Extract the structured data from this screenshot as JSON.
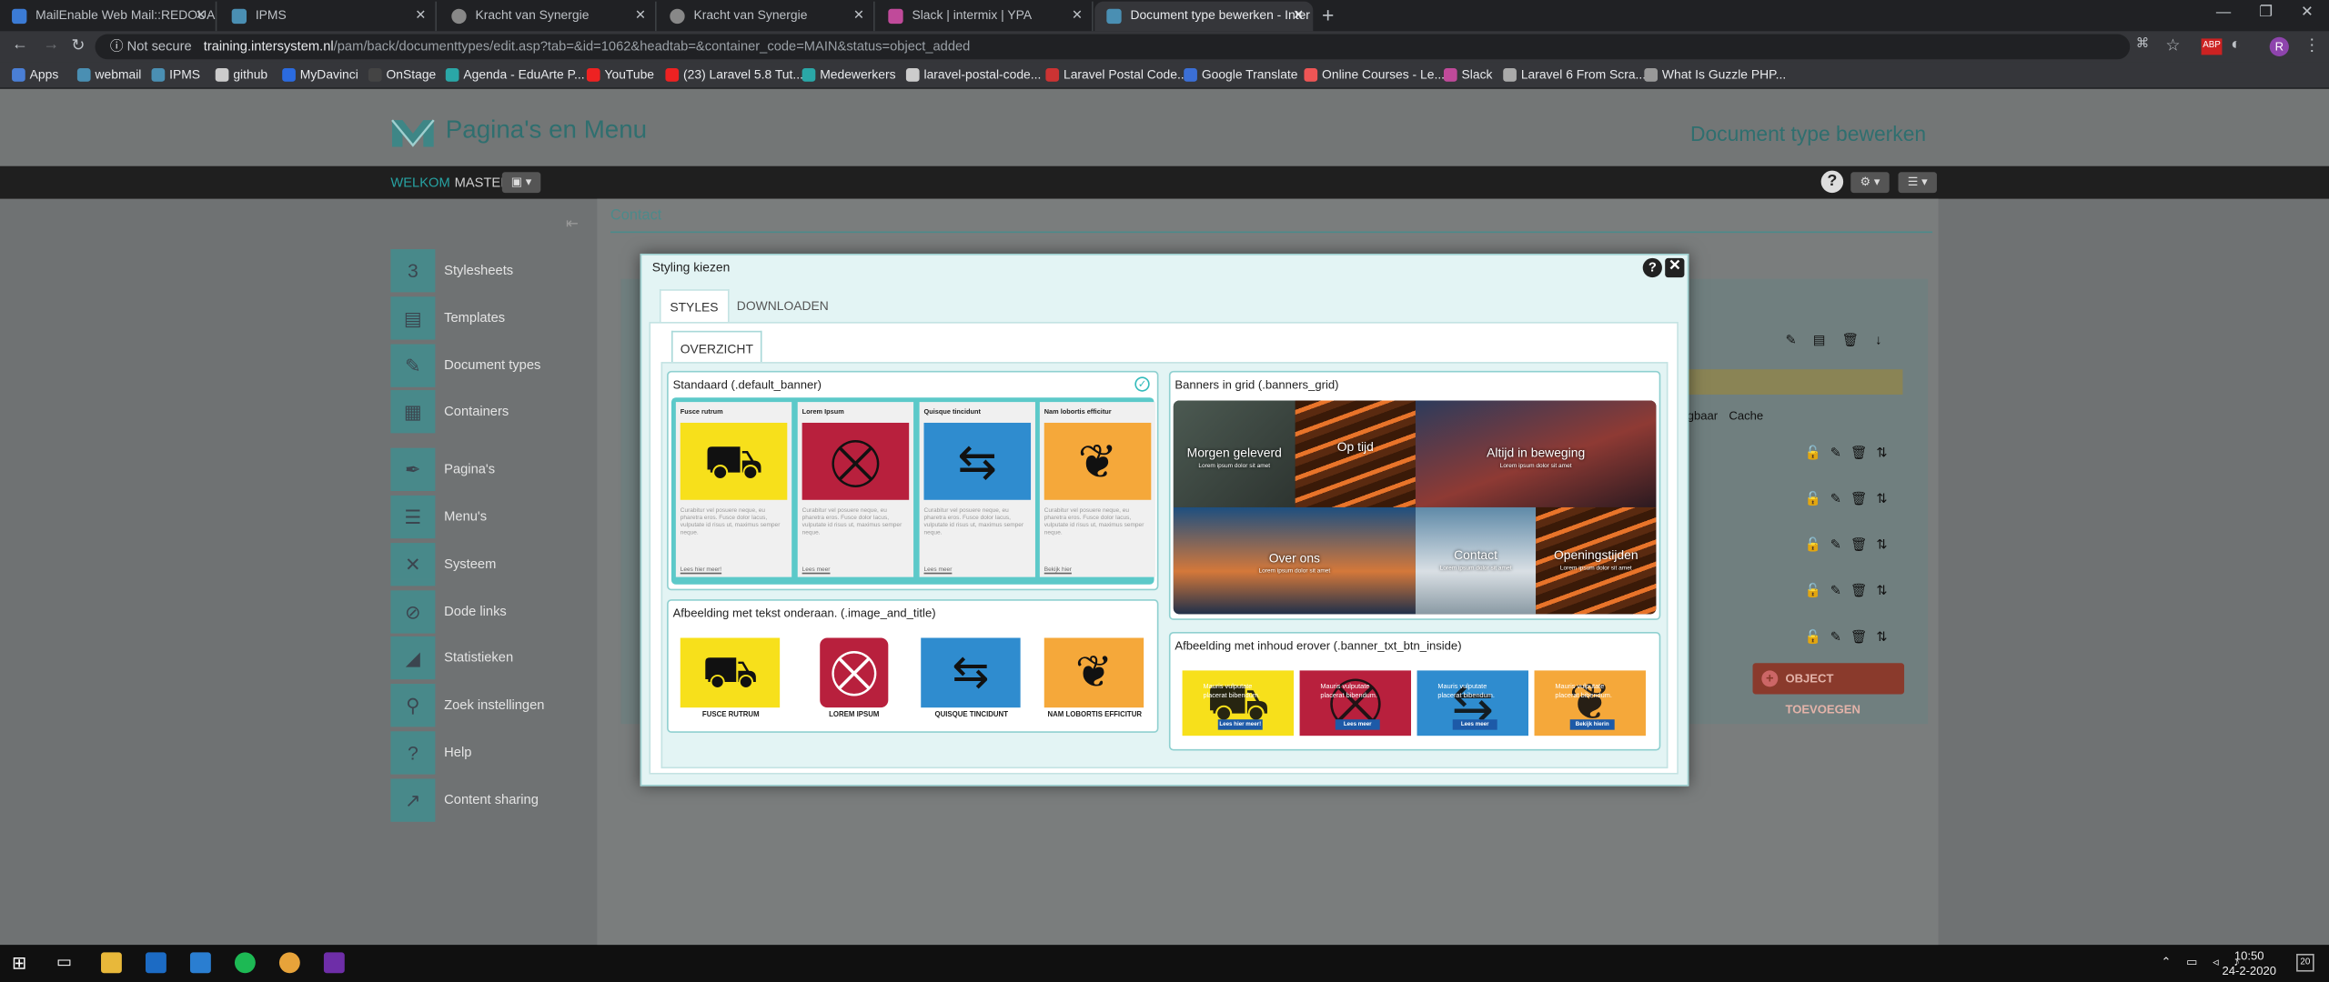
{
  "browser": {
    "tabs": [
      {
        "label": "MailEnable Web Mail::REDOUAN",
        "active": false
      },
      {
        "label": "IPMS",
        "active": false
      },
      {
        "label": "Kracht van Synergie",
        "active": false
      },
      {
        "label": "Kracht van Synergie",
        "active": false
      },
      {
        "label": "Slack | intermix | YPA",
        "active": false
      },
      {
        "label": "Document type bewerken - Inter",
        "active": true
      }
    ],
    "not_secure": "Not secure",
    "url_host": "training.intersystem.nl",
    "url_rest": "/pam/back/documenttypes/edit.asp?tab=&id=1062&headtab=&container_code=MAIN&status=object_added",
    "bookmarks": [
      "Apps",
      "webmail",
      "IPMS",
      "github",
      "MyDavinci",
      "OnStage",
      "Agenda - EduArte P...",
      "YouTube",
      "(23) Laravel 5.8 Tut...",
      "Medewerkers",
      "laravel-postal-code...",
      "Laravel Postal Code...",
      "Google Translate",
      "Online Courses - Le...",
      "Slack",
      "Laravel 6 From Scra...",
      "What Is Guzzle PHP..."
    ]
  },
  "app": {
    "title": "Pagina's en Menu",
    "subtitle": "Document type bewerken",
    "welkom": "WELKOM",
    "user": "MASTER",
    "sidebar": [
      "Stylesheets",
      "Templates",
      "Document types",
      "Containers",
      "Pagina's",
      "Menu's",
      "Systeem",
      "Dode links",
      "Statistieken",
      "Zoek instellingen",
      "Help",
      "Content sharing"
    ],
    "contact": "Contact",
    "object_button": "OBJECT TOEVOEGEN",
    "col_zichtbaar": "gbaar",
    "col_cache": "Cache"
  },
  "modal": {
    "title": "Styling kiezen",
    "tabs": [
      "STYLES",
      "DOWNLOADEN"
    ],
    "subtab": "OVERZICHT",
    "cards": {
      "default_banner": {
        "title": "Standaard (.default_banner)",
        "items": [
          {
            "heading": "Fusce rutrum",
            "link": "Lees hier meer!",
            "color": "#f7e01b"
          },
          {
            "heading": "Lorem Ipsum",
            "link": "Lees meer",
            "color": "#b8203d"
          },
          {
            "heading": "Quisque tincidunt",
            "link": "Lees meer",
            "color": "#2f8ccf"
          },
          {
            "heading": "Nam lobortis efficitur",
            "link": "Bekijk hier",
            "color": "#f5a83a"
          }
        ],
        "body": "Curabitur vel posuere neque, eu pharetra eros. Fusce dolor lacus, vulputate id risus ut, maximus semper neque."
      },
      "banners_grid": {
        "title": "Banners in grid (.banners_grid)",
        "cells": [
          "Morgen geleverd",
          "Op tijd",
          "Altijd in beweging",
          "Over ons",
          "Contact",
          "Openingstijden"
        ],
        "cell_sub": "Lorem ipsum dolor sit amet"
      },
      "image_and_title": {
        "title": "Afbeelding met tekst onderaan. (.image_and_title)",
        "captions": [
          "FUSCE RUTRUM",
          "LOREM IPSUM",
          "QUISQUE TINCIDUNT",
          "NAM LOBORTIS EFFICITUR"
        ]
      },
      "banner_txt_btn_inside": {
        "title": "Afbeelding met inhoud erover (.banner_txt_btn_inside)",
        "texts": [
          "Mauris vulputate placerat bibendum.",
          "Mauris vulputate placerat bibendum.",
          "Mauris vulputate placerat bibendum.",
          "Mauris vulputate placerat bibendum."
        ],
        "buttons": [
          "Lees hier meer!",
          "Lees meer",
          "Lees meer",
          "Bekijk hierin"
        ]
      }
    }
  },
  "taskbar": {
    "time": "10:50",
    "date": "24-2-2020"
  },
  "colors": {
    "accent": "#2a9d9d",
    "yellow": "#f7e01b",
    "red": "#b8203d",
    "blue": "#2f8ccf",
    "orange": "#f5a83a"
  }
}
